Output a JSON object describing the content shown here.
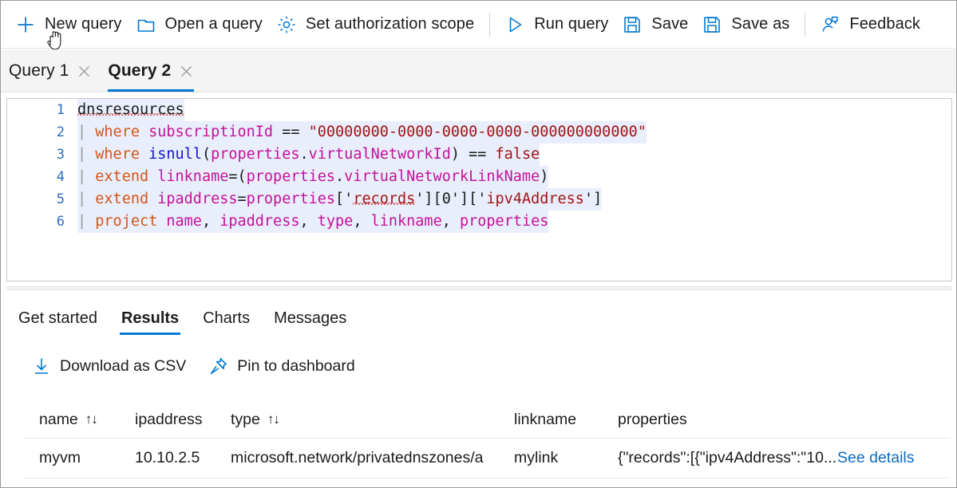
{
  "toolbar": {
    "items": [
      {
        "id": "new-query",
        "label": "New query",
        "icon": "plus-icon"
      },
      {
        "id": "open-query",
        "label": "Open a query",
        "icon": "folder-icon"
      },
      {
        "id": "set-scope",
        "label": "Set authorization scope",
        "icon": "gear-icon"
      },
      {
        "id": "run-query",
        "label": "Run query",
        "icon": "play-icon"
      },
      {
        "id": "save",
        "label": "Save",
        "icon": "save-icon"
      },
      {
        "id": "save-as",
        "label": "Save as",
        "icon": "save-as-icon"
      },
      {
        "id": "feedback",
        "label": "Feedback",
        "icon": "feedback-icon"
      }
    ]
  },
  "query_tabs": [
    {
      "label": "Query 1",
      "active": false,
      "close": "✕"
    },
    {
      "label": "Query 2",
      "active": true,
      "close": "✕"
    }
  ],
  "editor": {
    "line_numbers": [
      "1",
      "2",
      "3",
      "4",
      "5",
      "6"
    ],
    "lines": [
      "dnsresources",
      "| where subscriptionId == \"00000000-0000-0000-0000-000000000000\"",
      "| where isnull(properties.virtualNetworkId) == false",
      "| extend linkname=(properties.virtualNetworkLinkName)",
      "| extend ipaddress=properties['records'][0]['ipv4Address']",
      "| project name, ipaddress, type, linkname, properties"
    ],
    "tokens": {
      "table": "dnsresources",
      "l2": {
        "pipe": "|",
        "kw": "where",
        "id": "subscriptionId",
        "op": "==",
        "str": "\"00000000-0000-0000-0000-000000000000\""
      },
      "l3": {
        "pipe": "|",
        "kw": "where",
        "fn": "isnull",
        "open": "(",
        "id": "properties",
        "dot": ".",
        "id2": "virtualNetworkId",
        "close": ")",
        "op": "==",
        "lit": "false"
      },
      "l4": {
        "pipe": "|",
        "kw": "extend",
        "id": "linkname",
        "eq": "=",
        "open": "(",
        "id2": "properties",
        "dot": ".",
        "id3": "virtualNetworkLinkName",
        "close": ")"
      },
      "l5": {
        "pipe": "|",
        "kw": "extend",
        "id": "ipaddress",
        "eq": "=",
        "id2": "properties",
        "b1": "['",
        "s1": "records",
        "b2": "'][",
        "num": "0",
        "b3": "']['",
        "s2": "ipv4Address",
        "b4": "']"
      },
      "l6": {
        "pipe": "|",
        "kw": "project",
        "c1": "name",
        "c2": "ipaddress",
        "c3": "type",
        "c4": "linkname",
        "c5": "properties",
        "comma": ","
      }
    }
  },
  "result_tabs": [
    {
      "label": "Get started",
      "active": false
    },
    {
      "label": "Results",
      "active": true
    },
    {
      "label": "Charts",
      "active": false
    },
    {
      "label": "Messages",
      "active": false
    }
  ],
  "result_actions": [
    {
      "id": "download-csv",
      "label": "Download as CSV",
      "icon": "download-icon"
    },
    {
      "id": "pin-to-dashboard",
      "label": "Pin to dashboard",
      "icon": "pin-icon"
    }
  ],
  "results_table": {
    "columns": [
      {
        "key": "name",
        "label": "name",
        "sortable": true,
        "sort_glyph": "↑↓"
      },
      {
        "key": "ipaddress",
        "label": "ipaddress",
        "sortable": false,
        "sort_glyph": ""
      },
      {
        "key": "type",
        "label": "type",
        "sortable": true,
        "sort_glyph": "↑↓"
      },
      {
        "key": "linkname",
        "label": "linkname",
        "sortable": false,
        "sort_glyph": ""
      },
      {
        "key": "properties",
        "label": "properties",
        "sortable": false,
        "sort_glyph": ""
      }
    ],
    "rows": [
      {
        "name": "myvm",
        "ipaddress": "10.10.2.5",
        "type": "microsoft.network/privatednszones/a",
        "linkname": "mylink",
        "properties": "{\"records\":[{\"ipv4Address\":\"10....",
        "details_label": "See details"
      }
    ]
  },
  "colors": {
    "accent": "#0078d4",
    "link": "#0f6cbd",
    "text": "#1b1b1b",
    "tab_strip_bg": "#f4f4f4",
    "selection": "#e8eefb",
    "keyword": "#d2581b",
    "identifier": "#c5129b",
    "function": "#1414d2",
    "string": "#a31515",
    "line_number": "#2b6cbf",
    "squiggle": "#cc0000"
  }
}
